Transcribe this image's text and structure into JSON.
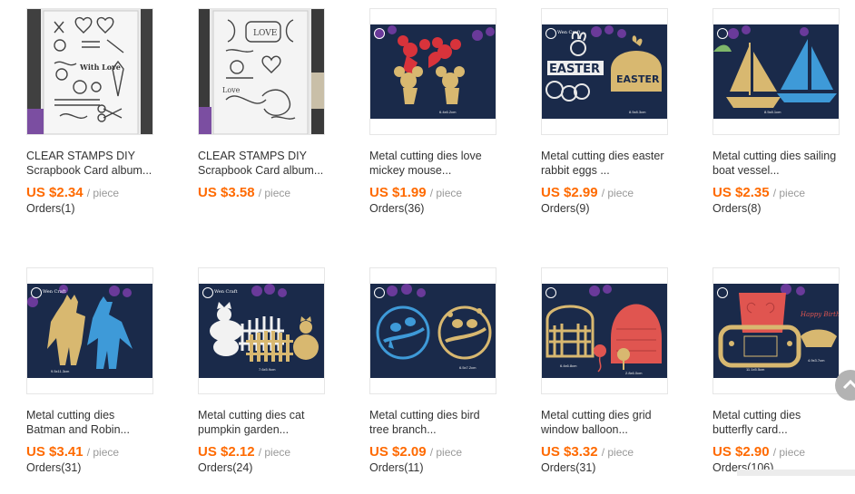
{
  "products": [
    {
      "title_line1": "CLEAR STAMPS DIY",
      "title_line2": "Scrapbook Card album...",
      "price": "US $2.34",
      "unit": "/ piece",
      "orders": "Orders(1)",
      "image_icon": "clear-stamp-sheet"
    },
    {
      "title_line1": "CLEAR STAMPS DIY",
      "title_line2": "Scrapbook Card album...",
      "price": "US $3.58",
      "unit": "/ piece",
      "orders": "",
      "image_icon": "clear-stamp-sheet-love"
    },
    {
      "title_line1": "Metal cutting dies love",
      "title_line2": "mickey mouse...",
      "price": "US $1.99",
      "unit": "/ piece",
      "orders": "Orders(36)",
      "image_icon": "mickey-die"
    },
    {
      "title_line1": "Metal cutting dies easter",
      "title_line2": "rabbit eggs ...",
      "price": "US $2.99",
      "unit": "/ piece",
      "orders": "Orders(9)",
      "image_icon": "easter-die"
    },
    {
      "title_line1": "Metal cutting dies sailing",
      "title_line2": "boat vessel...",
      "price": "US $2.35",
      "unit": "/ piece",
      "orders": "Orders(8)",
      "image_icon": "sailboat-die"
    },
    {
      "title_line1": "Metal cutting dies",
      "title_line2": "Batman and Robin...",
      "price": "US $3.41",
      "unit": "/ piece",
      "orders": "Orders(31)",
      "image_icon": "batman-die"
    },
    {
      "title_line1": "Metal cutting dies cat",
      "title_line2": "pumpkin garden...",
      "price": "US $2.12",
      "unit": "/ piece",
      "orders": "Orders(24)",
      "image_icon": "cat-pumpkin-die"
    },
    {
      "title_line1": "Metal cutting dies bird",
      "title_line2": "tree branch...",
      "price": "US $2.09",
      "unit": "/ piece",
      "orders": "Orders(11)",
      "image_icon": "bird-branch-die"
    },
    {
      "title_line1": "Metal cutting dies grid",
      "title_line2": "window balloon...",
      "price": "US $3.32",
      "unit": "/ piece",
      "orders": "Orders(31)",
      "image_icon": "window-balloon-die"
    },
    {
      "title_line1": "Metal cutting dies",
      "title_line2": "butterfly card...",
      "price": "US $2.90",
      "unit": "/ piece",
      "orders": "Orders(106)",
      "image_icon": "butterfly-card-die"
    }
  ],
  "image_labels": {
    "stamp_love_word": "Love",
    "stamp_love_box": "LOVE",
    "easter_word": "EASTER",
    "easter_word_gold": "EASTER",
    "birthday_text": "Happy Birthday",
    "size_mickey": "6.4x6.2cm",
    "size_easter": "8.5x8.3cm",
    "size_sailboat": "8.5x8.1cm",
    "size_batman": "9.5x11.3cm",
    "size_cat": "7.6x5.9cm",
    "size_bird": "6.5x7.2cm",
    "size_window": "6.4x6.8cm",
    "size_balloon": "2.8x6.0cm",
    "size_butterfly": "11.1x5.5cm",
    "size_birthday": "4.9x3.7cm",
    "brand": "Wen Craft"
  },
  "colors": {
    "price": "#ff6a00",
    "navy_bg": "#1a2a4a",
    "gold": "#d8b870",
    "red_die": "#d8333b",
    "blue_die": "#3e9ad8",
    "stamp_bg": "#f2f2f2"
  }
}
